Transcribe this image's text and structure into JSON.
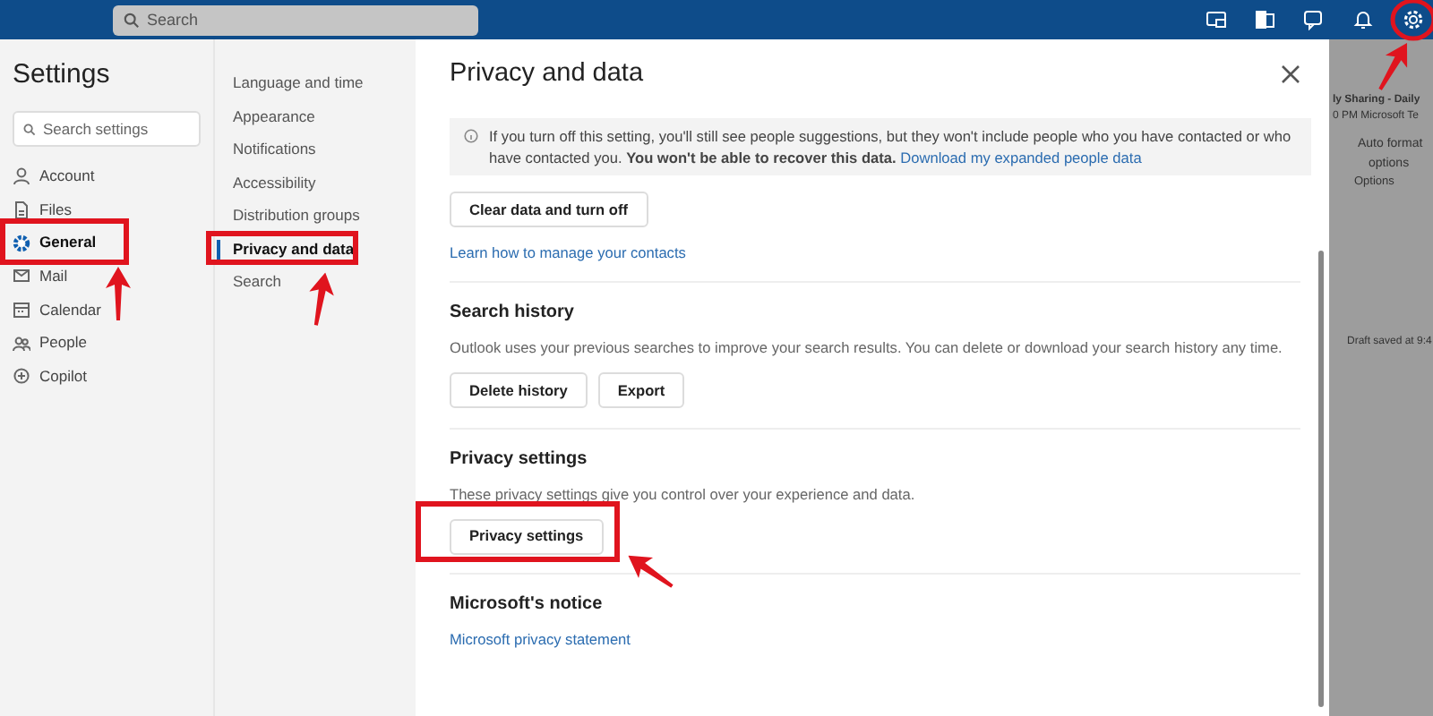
{
  "top_bar": {
    "search_placeholder": "Search",
    "icons_highlighted": [
      false,
      false,
      false,
      false,
      true
    ]
  },
  "settings": {
    "title": "Settings",
    "search_placeholder": "Search settings",
    "categories": [
      {
        "label": "Account",
        "selected": false,
        "highlighted": false
      },
      {
        "label": "Files",
        "selected": false,
        "highlighted": false
      },
      {
        "label": "General",
        "selected": true,
        "highlighted": true
      },
      {
        "label": "Mail",
        "selected": false,
        "highlighted": false
      },
      {
        "label": "Calendar",
        "selected": false,
        "highlighted": false
      },
      {
        "label": "People",
        "selected": false,
        "highlighted": false
      },
      {
        "label": "Copilot",
        "selected": false,
        "highlighted": false
      }
    ]
  },
  "subcategories": [
    {
      "label": "Language and time",
      "selected": false,
      "highlighted": false
    },
    {
      "label": "Appearance",
      "selected": false,
      "highlighted": false
    },
    {
      "label": "Notifications",
      "selected": false,
      "highlighted": false
    },
    {
      "label": "Accessibility",
      "selected": false,
      "highlighted": false
    },
    {
      "label": "Distribution groups",
      "selected": false,
      "highlighted": false
    },
    {
      "label": "Privacy and data",
      "selected": true,
      "highlighted": true
    },
    {
      "label": "Search",
      "selected": false,
      "highlighted": false
    }
  ],
  "panel": {
    "title": "Privacy and data",
    "info": {
      "text": "If you turn off this setting, you'll still see people suggestions, but they won't include people who you have contacted or who have contacted you. **You won't be able to recover this data.**",
      "link": "Download my expanded people data"
    },
    "sections": [
      {
        "buttons": [
          {
            "label": "Clear data and turn off",
            "highlighted": false
          }
        ],
        "link": "Learn how to manage your contacts"
      },
      {
        "heading": "Search history",
        "description": "Outlook uses your previous searches to improve your search results. You can delete or download your search history any time.",
        "buttons": [
          {
            "label": "Delete history",
            "highlighted": false
          },
          {
            "label": "Export",
            "highlighted": false
          }
        ]
      },
      {
        "heading": "Privacy settings",
        "description": "These privacy settings give you control over your experience and data.",
        "buttons": [
          {
            "label": "Privacy settings",
            "highlighted": true
          }
        ]
      },
      {
        "heading": "Microsoft's notice",
        "link": "Microsoft privacy statement"
      }
    ]
  },
  "background": {
    "fragments": [
      "ly Sharing - Daily",
      "0 PM Microsoft Te",
      "Auto format",
      "options",
      "Options",
      "Draft saved at 9:4"
    ]
  }
}
